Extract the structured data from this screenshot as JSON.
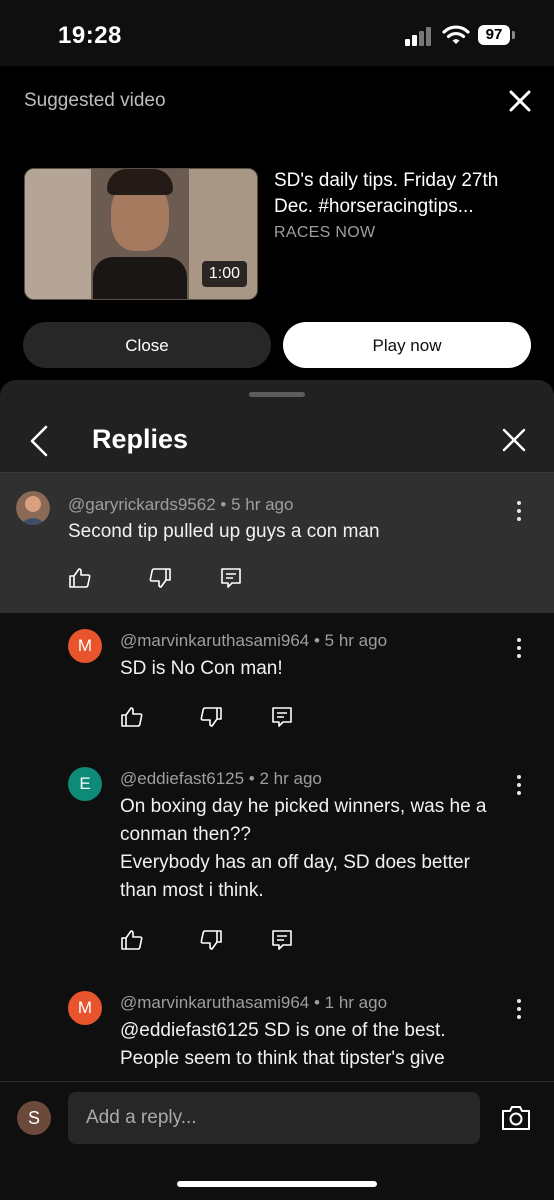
{
  "status": {
    "time": "19:28",
    "battery": "97"
  },
  "suggested": {
    "header": "Suggested video",
    "video": {
      "title": "SD's daily tips. Friday 27th Dec. #horseracingtips...",
      "channel": "RACES NOW",
      "duration": "1:00"
    },
    "close_label": "Close",
    "play_label": "Play now"
  },
  "replies": {
    "title": "Replies",
    "parent": {
      "author": "@garyrickards9562",
      "time": "5 hr ago",
      "text": "Second tip pulled up guys a con man"
    },
    "items": [
      {
        "avatar_letter": "M",
        "avatar_color": "#e8542b",
        "author": "@marvinkaruthasami964",
        "time": "5 hr ago",
        "lines": [
          "SD is No Con man!"
        ]
      },
      {
        "avatar_letter": "E",
        "avatar_color": "#0e8a78",
        "author": "@eddiefast6125",
        "time": "2 hr ago",
        "lines": [
          "On boxing day he picked winners, was he a",
          "conman then??",
          "Everybody has an off day, SD does better",
          "than most i think."
        ]
      },
      {
        "avatar_letter": "M",
        "avatar_color": "#e8542b",
        "author": "@marvinkaruthasami964",
        "time": "1 hr ago",
        "lines": [
          "@eddiefast6125  SD is one of the best.",
          "People seem to think that tipster's give"
        ]
      }
    ]
  },
  "composer": {
    "avatar_letter": "S",
    "placeholder": "Add a reply..."
  }
}
